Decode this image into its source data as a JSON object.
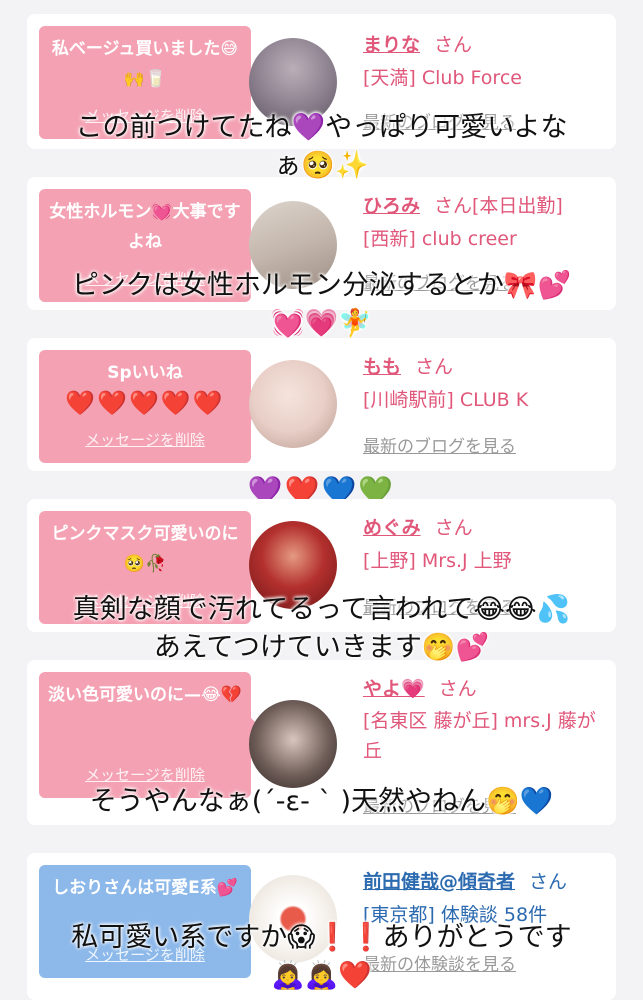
{
  "cards": [
    {
      "message": "私ベージュ買いました😅🙌🥛",
      "delete_label": "メッセージを削除",
      "name": "まりな",
      "honorific": "さん",
      "name_suffix": "",
      "shop": "[天満] Club Force",
      "link": "最新のブログを見る",
      "avatar_color": "#8a7e8c"
    },
    {
      "message": "女性ホルモン💓大事ですよね",
      "delete_label": "メッセージを削除",
      "name": "ひろみ",
      "honorific": "さん[本日出勤]",
      "name_suffix": "",
      "shop": "[西新] club creer",
      "link": "最新のブログを見る",
      "avatar_color": "#c4b7ad"
    },
    {
      "message": "Spいいね",
      "hearts": "❤️❤️❤️❤️❤️",
      "delete_label": "メッセージを削除",
      "name": "もも",
      "honorific": "さん",
      "shop": "[川崎駅前] CLUB K",
      "link": "最新のブログを見る",
      "avatar_color": "#e8cfc7"
    },
    {
      "message": "ピンクマスク可愛いのに🥺🥀",
      "delete_label": "メッセージを削除",
      "name": "めぐみ",
      "honorific": "さん",
      "shop": "[上野] Mrs.J 上野",
      "link": "最新のブログを見る",
      "avatar_color": "#b3302e"
    },
    {
      "message": "淡い色可愛いのに—😂💔",
      "delete_label": "メッセージを削除",
      "name": "やよ💗",
      "honorific": "さん",
      "shop": "[名東区 藤が丘] mrs.J 藤が丘",
      "link": "最新のブログを見る",
      "avatar_color": "#6f5d58"
    },
    {
      "message": "しおりさんは可愛E系💕",
      "delete_label": "メッセージを削除",
      "name": "前田健哉@傾奇者",
      "honorific": "さん",
      "shop": "[東京都] 体験談 58件",
      "link": "最新の体験談を見る",
      "avatar_color": "#f3eee8"
    }
  ],
  "overlays": {
    "o1_line1": "この前つけてたね💜やっぱり可愛いよな",
    "o1_line2": "ぁ🥺✨",
    "o2_line1": "ピンクは女性ホルモン分泌するとか🎀💕",
    "o2_line2": "💓💗🧚",
    "hearts_row": "💜❤️💙💚",
    "o3_line1": "真剣な顔で汚れてるって言われて😂😂💦",
    "o3_line2": "あえてつけていきます🤭💕",
    "o4_line1": "そうやんなぁ(´-ε- ` )天然やねん🤭💙",
    "o5_line1": "私可愛い系ですか😱❗️❗️ありがとうです",
    "o5_line2": "🙇‍♀️🙇‍♀️❤️"
  },
  "colors": {
    "pink_bubble": "#f4a2b3",
    "blue_bubble": "#8cb8ea",
    "pink_text": "#e0577a",
    "blue_text": "#2c6ab0"
  }
}
